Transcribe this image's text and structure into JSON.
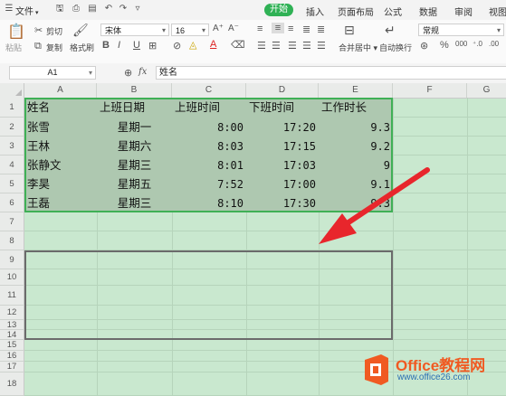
{
  "menubar": {
    "menu_label": "文件",
    "tabs": [
      "开始",
      "插入",
      "页面布局",
      "公式",
      "数据",
      "审阅",
      "视图"
    ]
  },
  "ribbon": {
    "paste": "粘贴",
    "cut": "剪切",
    "copy": "复制",
    "format_painter": "格式刷",
    "font_name": "宋体",
    "font_size": "16",
    "merge_center": "合并居中",
    "wrap_text": "自动换行",
    "number_format": "常规"
  },
  "formula_bar": {
    "name_box": "A1",
    "fx": "fx",
    "content": "姓名"
  },
  "columns": [
    "A",
    "B",
    "C",
    "D",
    "E",
    "F",
    "G"
  ],
  "rows": [
    "1",
    "2",
    "3",
    "4",
    "5",
    "6",
    "7",
    "8",
    "9",
    "10",
    "11",
    "12",
    "13",
    "14",
    "15",
    "16",
    "17",
    "18"
  ],
  "table": {
    "headers": [
      "姓名",
      "上班日期",
      "上班时间",
      "下班时间",
      "工作时长"
    ],
    "rows": [
      [
        "张雪",
        "星期一",
        "8:00",
        "17:20",
        "9.3"
      ],
      [
        "王林",
        "星期六",
        "8:03",
        "17:15",
        "9.2"
      ],
      [
        "张静文",
        "星期三",
        "8:01",
        "17:03",
        "9"
      ],
      [
        "李昊",
        "星期五",
        "7:52",
        "17:00",
        "9.1"
      ],
      [
        "王磊",
        "星期三",
        "8:10",
        "17:30",
        "9.3"
      ]
    ]
  },
  "watermark": {
    "brand": "Office教程网",
    "url": "www.office26.com"
  },
  "colors": {
    "accent_green": "#2fb155",
    "selection_border": "#3fb056",
    "arrow_red": "#e8262c",
    "logo_orange": "#f05a22"
  }
}
